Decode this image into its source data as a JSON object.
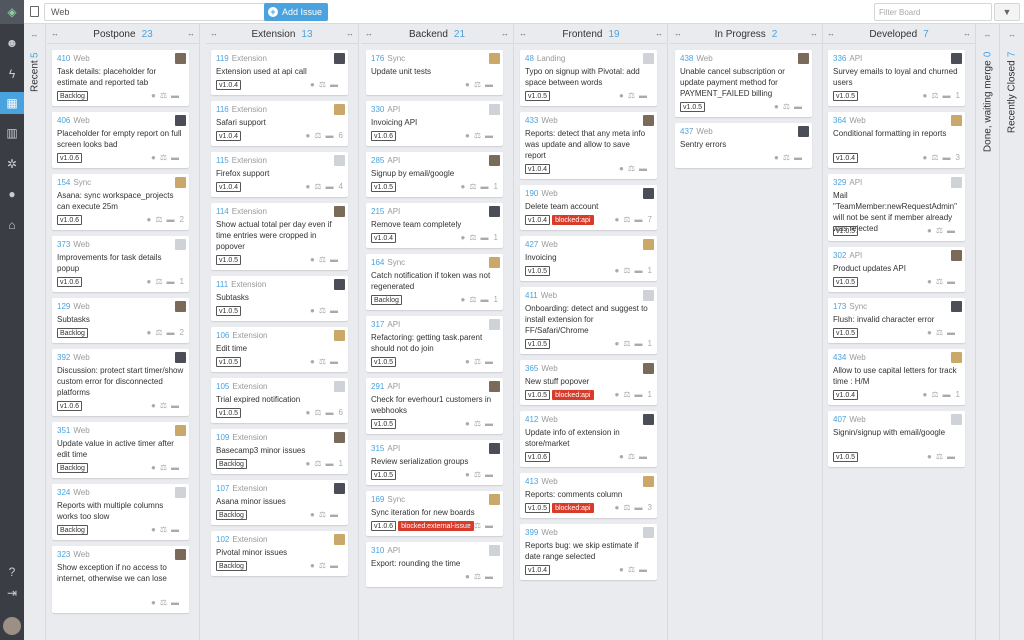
{
  "topbar": {
    "board_value": "Web",
    "add_issue_label": "Add Issue",
    "filter_placeholder": "Filter Board"
  },
  "recent": {
    "label": "Recent",
    "count": "5"
  },
  "done": {
    "label": "Done, waiting merge",
    "count": "0"
  },
  "closed": {
    "label": "Recently Closed",
    "count": "7"
  },
  "columns": [
    {
      "title": "Postpone",
      "count": "23",
      "cards": [
        {
          "num": "410",
          "tag": "Web",
          "title": "Task details: placeholder for estimate and reported tab",
          "badges": [
            "Backlog"
          ],
          "red": [],
          "comments": ""
        },
        {
          "num": "406",
          "tag": "Web",
          "title": "Placeholder for empty report on full screen looks bad",
          "badges": [
            "v1.0.6"
          ],
          "red": [],
          "comments": ""
        },
        {
          "num": "154",
          "tag": "Sync",
          "title": "Asana: sync workspace_projects can execute 25m",
          "badges": [
            "v1.0.6"
          ],
          "red": [],
          "comments": "2"
        },
        {
          "num": "373",
          "tag": "Web",
          "title": "Improvements for task details popup",
          "badges": [
            "v1.0.6"
          ],
          "red": [],
          "comments": "1"
        },
        {
          "num": "129",
          "tag": "Web",
          "title": "Subtasks",
          "badges": [
            "Backlog"
          ],
          "red": [],
          "comments": "2"
        },
        {
          "num": "392",
          "tag": "Web",
          "title": "Discussion: protect start timer/show custom error for disconnected platforms",
          "badges": [
            "v1.0.6"
          ],
          "red": [],
          "comments": ""
        },
        {
          "num": "351",
          "tag": "Web",
          "title": "Update value in active timer after edit time",
          "badges": [
            "Backlog"
          ],
          "red": [],
          "comments": ""
        },
        {
          "num": "324",
          "tag": "Web",
          "title": "Reports with multiple columns works too slow",
          "badges": [
            "Backlog"
          ],
          "red": [],
          "comments": ""
        },
        {
          "num": "323",
          "tag": "Web",
          "title": "Show exception if no access to internet, otherwise we can lose",
          "badges": [],
          "red": [],
          "comments": ""
        }
      ]
    },
    {
      "title": "Extension",
      "count": "13",
      "cards": [
        {
          "num": "119",
          "tag": "Extension",
          "title": "Extension used at api call",
          "badges": [
            "v1.0.4"
          ],
          "red": [],
          "comments": ""
        },
        {
          "num": "116",
          "tag": "Extension",
          "title": "Safari support",
          "badges": [
            "v1.0.4"
          ],
          "red": [],
          "comments": "6"
        },
        {
          "num": "115",
          "tag": "Extension",
          "title": "Firefox support",
          "badges": [
            "v1.0.4"
          ],
          "red": [],
          "comments": "4"
        },
        {
          "num": "114",
          "tag": "Extension",
          "title": "Show actual total per day even if time entries were cropped in popover",
          "badges": [
            "v1.0.5"
          ],
          "red": [],
          "comments": ""
        },
        {
          "num": "111",
          "tag": "Extension",
          "title": "Subtasks",
          "badges": [
            "v1.0.5"
          ],
          "red": [],
          "comments": ""
        },
        {
          "num": "106",
          "tag": "Extension",
          "title": "Edit time",
          "badges": [
            "v1.0.5"
          ],
          "red": [],
          "comments": ""
        },
        {
          "num": "105",
          "tag": "Extension",
          "title": "Trial expired notification",
          "badges": [
            "v1.0.5"
          ],
          "red": [],
          "comments": "6"
        },
        {
          "num": "109",
          "tag": "Extension",
          "title": "Basecamp3 minor issues",
          "badges": [
            "Backlog"
          ],
          "red": [],
          "comments": "1"
        },
        {
          "num": "107",
          "tag": "Extension",
          "title": "Asana minor issues",
          "badges": [
            "Backlog"
          ],
          "red": [],
          "comments": ""
        },
        {
          "num": "102",
          "tag": "Extension",
          "title": "Pivotal minor issues",
          "badges": [
            "Backlog"
          ],
          "red": [],
          "comments": ""
        }
      ]
    },
    {
      "title": "Backend",
      "count": "21",
      "cards": [
        {
          "num": "176",
          "tag": "Sync",
          "title": "Update unit tests",
          "badges": [],
          "red": [],
          "comments": ""
        },
        {
          "num": "330",
          "tag": "API",
          "title": "Invoicing API",
          "badges": [
            "v1.0.6"
          ],
          "red": [],
          "comments": ""
        },
        {
          "num": "285",
          "tag": "API",
          "title": "Signup by email/google",
          "badges": [
            "v1.0.5"
          ],
          "red": [],
          "comments": "1"
        },
        {
          "num": "215",
          "tag": "API",
          "title": "Remove team completely",
          "badges": [
            "v1.0.4"
          ],
          "red": [],
          "comments": "1"
        },
        {
          "num": "164",
          "tag": "Sync",
          "title": "Catch notification if token was not regenerated",
          "badges": [
            "Backlog"
          ],
          "red": [],
          "comments": "1"
        },
        {
          "num": "317",
          "tag": "API",
          "title": "Refactoring: getting task.parent should not do join",
          "badges": [
            "v1.0.5"
          ],
          "red": [],
          "comments": ""
        },
        {
          "num": "291",
          "tag": "API",
          "title": "Check for everhour1 customers in webhooks",
          "badges": [
            "v1.0.5"
          ],
          "red": [],
          "comments": ""
        },
        {
          "num": "315",
          "tag": "API",
          "title": "Review serialization groups",
          "badges": [
            "v1.0.5"
          ],
          "red": [],
          "comments": ""
        },
        {
          "num": "169",
          "tag": "Sync",
          "title": "Sync iteration for new boards",
          "badges": [
            "v1.0.6"
          ],
          "red": [
            "blocked:external-issue"
          ],
          "comments": ""
        },
        {
          "num": "310",
          "tag": "API",
          "title": "Export: rounding the time",
          "badges": [],
          "red": [],
          "comments": ""
        }
      ]
    },
    {
      "title": "Frontend",
      "count": "19",
      "cards": [
        {
          "num": "48",
          "tag": "Landing",
          "title": "Typo on signup with Pivotal: add space between words",
          "badges": [
            "v1.0.5"
          ],
          "red": [],
          "comments": ""
        },
        {
          "num": "433",
          "tag": "Web",
          "title": "Reports: detect that any meta info was update and allow to save report",
          "badges": [
            "v1.0.4"
          ],
          "red": [],
          "comments": ""
        },
        {
          "num": "190",
          "tag": "Web",
          "title": "Delete team account",
          "badges": [
            "v1.0.4"
          ],
          "red": [
            "blocked:api"
          ],
          "comments": "7"
        },
        {
          "num": "427",
          "tag": "Web",
          "title": "Invoicing",
          "badges": [
            "v1.0.5"
          ],
          "red": [],
          "comments": "1"
        },
        {
          "num": "411",
          "tag": "Web",
          "title": "Onboarding: detect and suggest to install extension for FF/Safari/Chrome",
          "badges": [
            "v1.0.5"
          ],
          "red": [],
          "comments": "1"
        },
        {
          "num": "365",
          "tag": "Web",
          "title": "New stuff popover",
          "badges": [
            "v1.0.5"
          ],
          "red": [
            "blocked:api"
          ],
          "comments": "1"
        },
        {
          "num": "412",
          "tag": "Web",
          "title": "Update info of extension in store/market",
          "badges": [
            "v1.0.6"
          ],
          "red": [],
          "comments": ""
        },
        {
          "num": "413",
          "tag": "Web",
          "title": "Reports: comments column",
          "badges": [
            "v1.0.5"
          ],
          "red": [
            "blocked:api"
          ],
          "comments": "3"
        },
        {
          "num": "399",
          "tag": "Web",
          "title": "Reports bug: we skip estimate if date range selected",
          "badges": [
            "v1.0.4"
          ],
          "red": [],
          "comments": ""
        }
      ]
    },
    {
      "title": "In Progress",
      "count": "2",
      "cards": [
        {
          "num": "438",
          "tag": "Web",
          "title": "Unable cancel subscription or update payment method for PAYMENT_FAILED billing",
          "badges": [
            "v1.0.5"
          ],
          "red": [],
          "comments": ""
        },
        {
          "num": "437",
          "tag": "Web",
          "title": "Sentry errors",
          "badges": [],
          "red": [],
          "comments": ""
        }
      ]
    },
    {
      "title": "Developed",
      "count": "7",
      "cards": [
        {
          "num": "336",
          "tag": "API",
          "title": "Survey emails to loyal and churned users",
          "badges": [
            "v1.0.5"
          ],
          "red": [],
          "comments": "1"
        },
        {
          "num": "364",
          "tag": "Web",
          "title": "Conditional formatting in reports",
          "badges": [
            "v1.0.4"
          ],
          "red": [],
          "comments": "3"
        },
        {
          "num": "329",
          "tag": "API",
          "title": "Mail \"TeamMember:newRequestAdmin\" will not be sent if member already was rejected",
          "badges": [
            "v1.0.5"
          ],
          "red": [],
          "comments": ""
        },
        {
          "num": "302",
          "tag": "API",
          "title": "Product updates API",
          "badges": [
            "v1.0.5"
          ],
          "red": [],
          "comments": ""
        },
        {
          "num": "173",
          "tag": "Sync",
          "title": "Flush: invalid character error",
          "badges": [
            "v1.0.5"
          ],
          "red": [],
          "comments": ""
        },
        {
          "num": "434",
          "tag": "Web",
          "title": "Allow to use capital letters for track time : H/M",
          "badges": [
            "v1.0.4"
          ],
          "red": [],
          "comments": "1"
        },
        {
          "num": "407",
          "tag": "Web",
          "title": "Signin/signup with email/google",
          "badges": [
            "v1.0.5"
          ],
          "red": [],
          "comments": ""
        }
      ]
    }
  ]
}
